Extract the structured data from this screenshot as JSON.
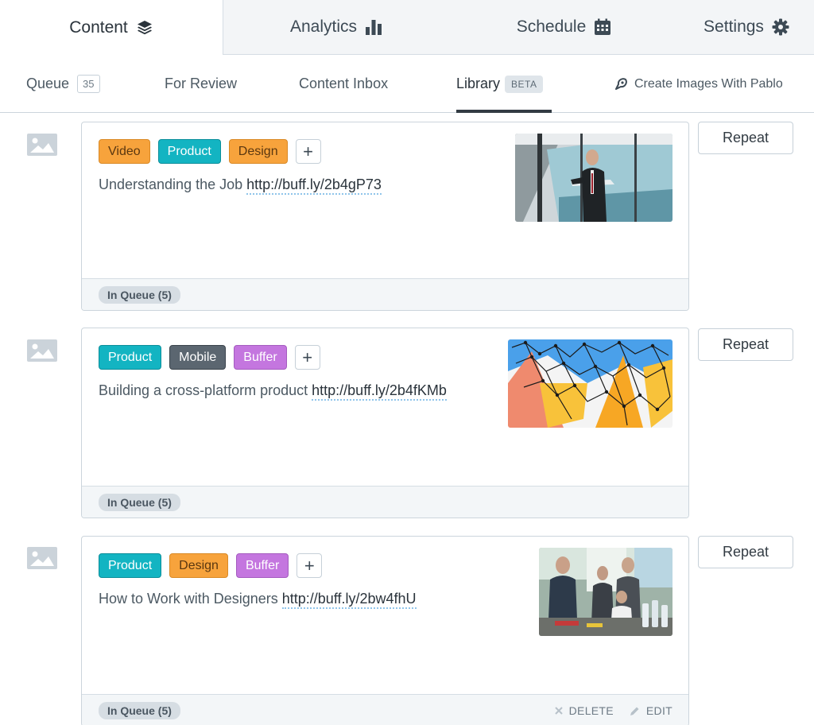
{
  "top_tabs": [
    {
      "label": "Content",
      "icon": "layers-icon",
      "active": true
    },
    {
      "label": "Analytics",
      "icon": "bar-chart-icon",
      "active": false
    },
    {
      "label": "Schedule",
      "icon": "calendar-icon",
      "active": false
    },
    {
      "label": "Settings",
      "icon": "gear-icon",
      "active": false
    }
  ],
  "sub_tabs": [
    {
      "label": "Queue",
      "badge": "35"
    },
    {
      "label": "For Review"
    },
    {
      "label": "Content Inbox"
    },
    {
      "label": "Library",
      "badge": "BETA",
      "active": true
    }
  ],
  "pablo": {
    "label": "Create Images With Pablo",
    "icon": "pablo-icon"
  },
  "posts": [
    {
      "tags": [
        "Video",
        "Product",
        "Design"
      ],
      "text": "Understanding the Job",
      "link": "http://buff.ly/2b4gP73",
      "status": "In Queue (5)",
      "repeat_label": "Repeat"
    },
    {
      "tags": [
        "Product",
        "Mobile",
        "Buffer"
      ],
      "text": "Building a cross-platform product",
      "link": "http://buff.ly/2b4fKMb",
      "status": "In Queue (5)",
      "repeat_label": "Repeat"
    },
    {
      "tags": [
        "Product",
        "Design",
        "Buffer"
      ],
      "text": "How to Work with Designers",
      "link": "http://buff.ly/2bw4fhU",
      "status": "In Queue (5)",
      "repeat_label": "Repeat",
      "actions": {
        "delete": "DELETE",
        "edit": "EDIT"
      }
    }
  ],
  "add_tag_symbol": "+",
  "colors": {
    "tag_orange": "#f7a33c",
    "tag_teal": "#13b4c2",
    "tag_gray": "#5b6670",
    "tag_purple": "#c476df",
    "text": "#323b43",
    "border": "#ccd5dc"
  }
}
